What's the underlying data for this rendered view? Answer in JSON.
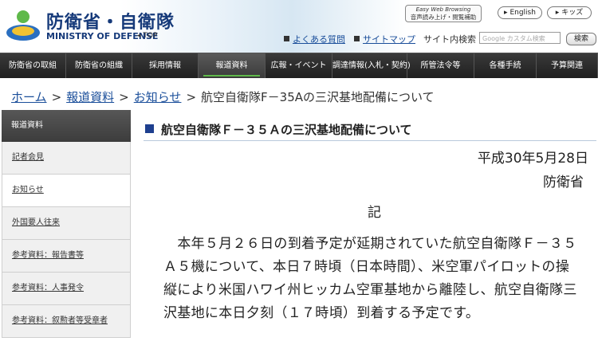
{
  "header": {
    "logo_jp": "防衛省・自衛隊",
    "logo_en": "MINISTRY OF DEFENSE",
    "top_link": "TOP",
    "easy_web_line1": "Easy Web Browsing",
    "easy_web_line2": "音声読み上げ・閲覧補助",
    "english_label": "English",
    "kids_label": "キッズ",
    "faq_label": "よくある質問",
    "sitemap_label": "サイトマップ",
    "search_label": "サイト内検索",
    "search_placeholder": "Google カスタム検索",
    "search_button": "検索"
  },
  "nav": [
    "防衛省の取組",
    "防衛省の組織",
    "採用情報",
    "報道資料",
    "広報・イベント",
    "調達情報(入札・契約)",
    "所管法令等",
    "各種手続",
    "予算関連"
  ],
  "nav_active_index": 3,
  "breadcrumb": {
    "home": "ホーム",
    "press": "報道資料",
    "notice": "お知らせ",
    "current": "航空自衛隊F－35Aの三沢基地配備について"
  },
  "sidebar": {
    "heading": "報道資料",
    "items": [
      "記者会見",
      "お知らせ",
      "外国要人往来",
      "参考資料：報告書等",
      "参考資料：人事発令",
      "参考資料：叙勲者等受章者"
    ],
    "current_index": 1
  },
  "article": {
    "title": "航空自衛隊Ｆ－３５Ａの三沢基地配備について",
    "date": "平成30年5月28日",
    "org": "防衛省",
    "ki": "記",
    "body": "本年５月２６日の到着予定が延期されていた航空自衛隊Ｆ－３５Ａ５機について、本日７時頃（日本時間）、米空軍パイロットの操縦により米国ハワイ州ヒッカム空軍基地から離陸し、航空自衛隊三沢基地に本日夕刻（１７時頃）到着する予定です。"
  },
  "colors": {
    "brand_navy": "#163a7a",
    "link_blue": "#1a4e9a",
    "nav_dark": "#2b2b2b",
    "nav_active_accent": "#5fb94a",
    "title_square": "#1e3f8f"
  }
}
